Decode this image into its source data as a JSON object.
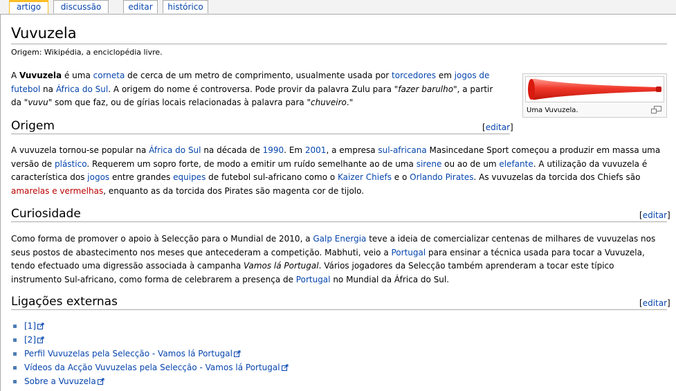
{
  "tabs": [
    {
      "label": "artigo"
    },
    {
      "label": "discussão"
    },
    {
      "label": "editar"
    },
    {
      "label": "histórico"
    }
  ],
  "page": {
    "title": "Vuvuzela",
    "site_sub": "Origem: Wikipédia, a enciclopédia livre."
  },
  "intro": {
    "t1": "A ",
    "bold": "Vuvuzela",
    "t2": " é uma ",
    "l_corneta": "corneta",
    "t3": " de cerca de um metro de comprimento, usualmente usada por ",
    "l_torcedores": "torcedores",
    "t4": " em ",
    "l_jogos": "jogos de futebol",
    "t5": " na ",
    "l_africa": "África do Sul",
    "t6": ". A origem do nome é controversa. Pode provir da palavra Zulu para \"",
    "i1": "fazer barulho",
    "t7": "\", a partir da \"",
    "i2": "vuvu",
    "t8": "\" som que faz, ou de gírias locais relacionadas à palavra para \"",
    "i3": "chuveiro",
    "t9": ".\""
  },
  "thumb": {
    "caption": "Uma Vuvuzela.",
    "icon": "magnify-clip-icon",
    "colors": {
      "horn_light": "#ff8a80",
      "horn_dark": "#d91a0e",
      "horn_mid": "#f0392b"
    }
  },
  "edit_label": "editar",
  "origem": {
    "heading": "Origem",
    "t1": "A vuvuzela tornou-se popular na ",
    "l_africa": "África do Sul",
    "t2": " na década de ",
    "l_1990": "1990",
    "t3": ". Em ",
    "l_2001": "2001",
    "t4": ", a empresa ",
    "l_sulafricana": "sul-africana",
    "t5": " Masincedane Sport começou a produzir em massa uma versão de ",
    "l_plastico": "plástico",
    "t6": ". Requerem um sopro forte, de modo a emitir um ruído semelhante ao de uma ",
    "l_sirene": "sirene",
    "t7": " ou ao de um ",
    "l_elefante": "elefante",
    "t8": ". A utilização da vuvuzela é característica dos ",
    "l_jogos": "jogos",
    "t9": " entre grandes ",
    "l_equipes": "equipes",
    "t10": " de futebol sul-africano como o ",
    "l_kaizer": "Kaizer Chiefs",
    "t11": " e o ",
    "l_orlando": "Orlando Pirates",
    "t12": ". As vuvuzelas da torcida dos Chiefs são ",
    "l_amarelas": "amarelas e vermelhas",
    "t13": ", enquanto as da torcida dos Pirates são magenta cor de tijolo."
  },
  "curiosidade": {
    "heading": "Curiosidade",
    "t1": "Como forma de promover o apoio à Selecção para o Mundial de 2010, a ",
    "l_galp": "Galp Energia",
    "t2": " teve a ideia de comercializar centenas de milhares de vuvuzelas nos seus postos de abastecimento nos meses que antecederam a competição. Mabhuti, veio a ",
    "l_portugal": "Portugal",
    "t3": " para ensinar a técnica usada para tocar a Vuvuzela, tendo efectuado uma digressão associada à campanha ",
    "i1": "Vamos lá Portugal",
    "t4": ". Vários jogadores da Selecção também aprenderam a tocar este típico instrumento Sul-africano, como forma de celebrarem a presença de ",
    "l_portugal2": "Portugal",
    "t5": " no Mundial da África do Sul."
  },
  "ligacoes": {
    "heading": "Ligações externas",
    "items": [
      {
        "label": "[1]"
      },
      {
        "label": "[2]"
      },
      {
        "label": "Perfil Vuvuzelas pela Selecção - Vamos lá Portugal"
      },
      {
        "label": "Vídeos da Acção Vuvuzelas pela Selecção - Vamos lá Portugal"
      },
      {
        "label": "Sobre a Vuvuzela"
      }
    ]
  }
}
